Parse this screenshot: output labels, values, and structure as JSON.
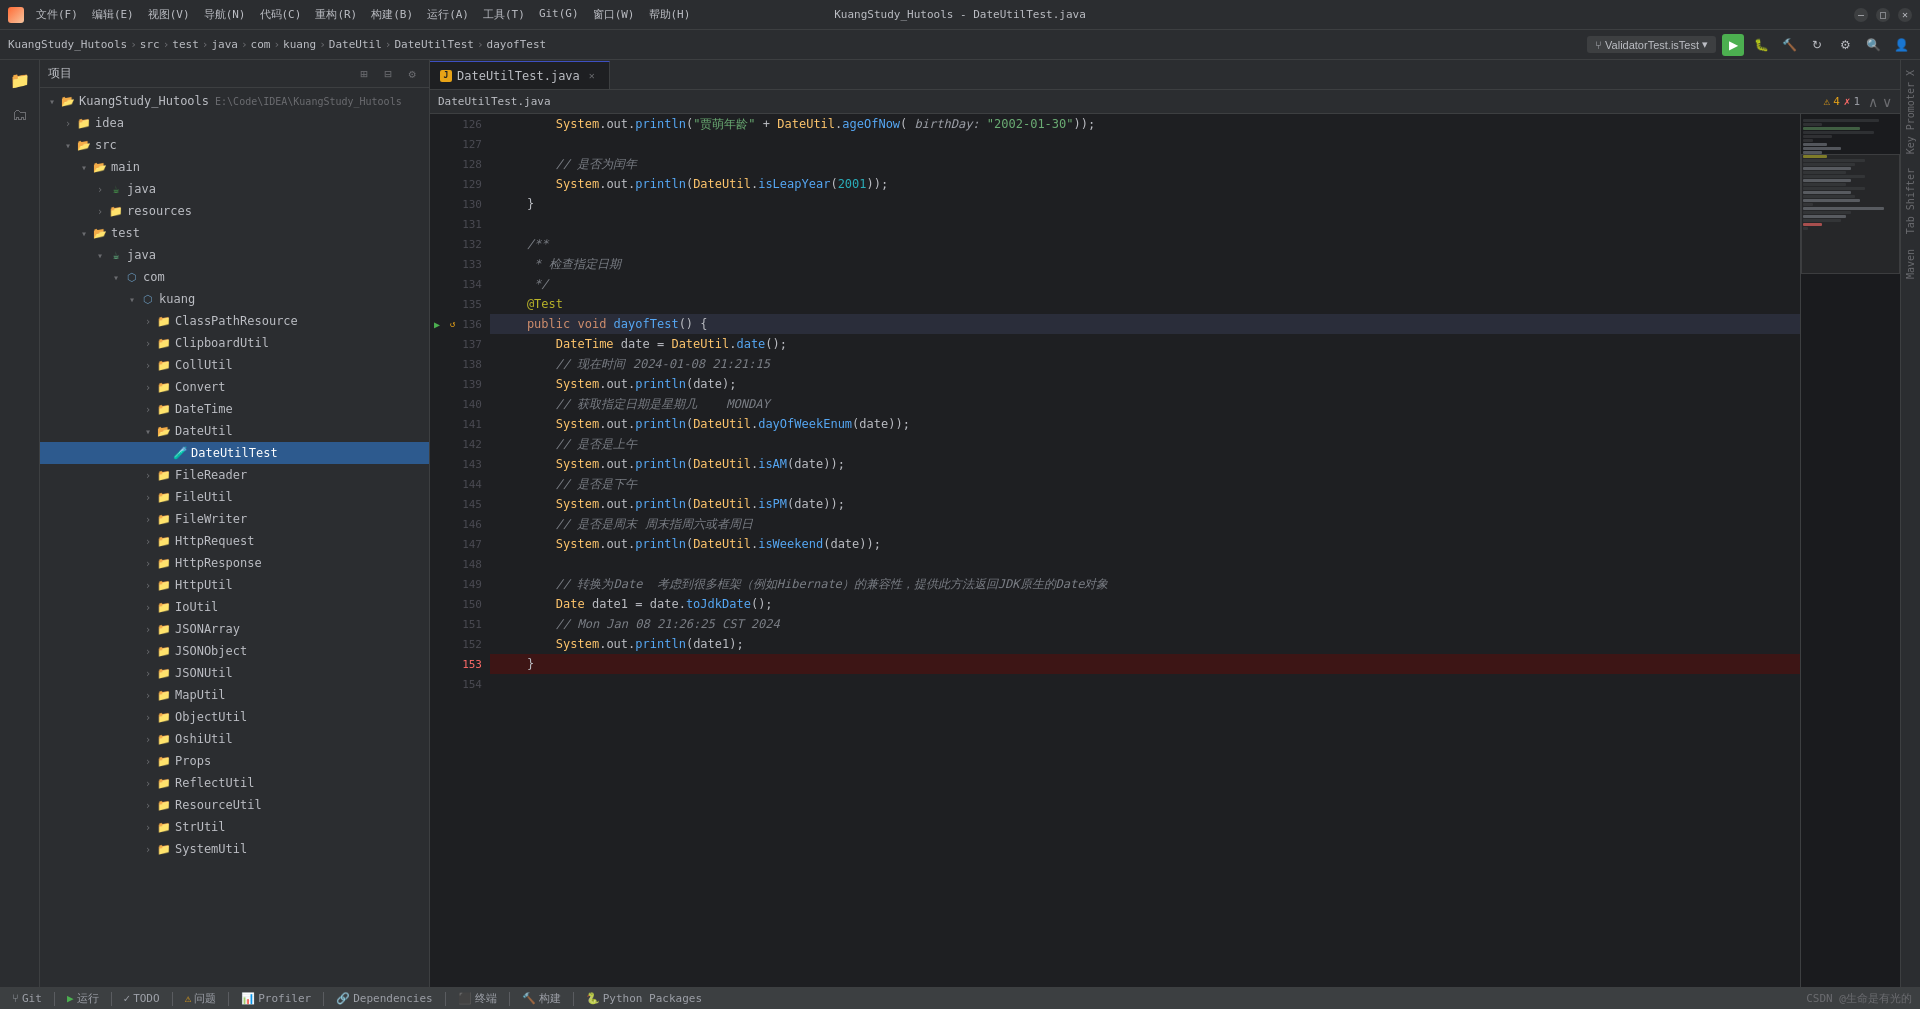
{
  "window": {
    "title": "KuangStudy_Hutools - DateUtilTest.java"
  },
  "titlebar": {
    "logo": "K",
    "menus": [
      "文件(F)",
      "编辑(E)",
      "视图(V)",
      "导航(N)",
      "代码(C)",
      "重构(R)",
      "构建(B)",
      "运行(A)",
      "工具(T)",
      "Git(G)",
      "窗口(W)",
      "帮助(H)"
    ],
    "branch": "ValidatorTest.isTest",
    "window_title": "KuangStudy_Hutools - DateUtilTest.java",
    "min_btn": "—",
    "max_btn": "□",
    "close_btn": "✕"
  },
  "breadcrumb": {
    "items": [
      "KuangStudy_Hutools",
      "src",
      "test",
      "java",
      "com",
      "kuang",
      "DateUtil",
      "DateUtilTest",
      "dayofTest"
    ]
  },
  "sidebar": {
    "title": "项目",
    "root": "KuangStudy_Hutools",
    "root_path": "E:\\Code\\IDEA\\KuangStudy_Hutools",
    "tree": [
      {
        "id": "root",
        "label": "KuangStudy_Hutools",
        "path": "E:\\Code\\IDEA\\KuangStudy_Hutools",
        "type": "project",
        "level": 0,
        "expanded": true
      },
      {
        "id": "idea",
        "label": "idea",
        "type": "folder",
        "level": 1,
        "expanded": false
      },
      {
        "id": "src",
        "label": "src",
        "type": "folder",
        "level": 1,
        "expanded": true
      },
      {
        "id": "main",
        "label": "main",
        "type": "folder",
        "level": 2,
        "expanded": true
      },
      {
        "id": "java-main",
        "label": "java",
        "type": "source-root",
        "level": 3,
        "expanded": false
      },
      {
        "id": "resources",
        "label": "resources",
        "type": "folder",
        "level": 3,
        "expanded": false
      },
      {
        "id": "test",
        "label": "test",
        "type": "folder",
        "level": 2,
        "expanded": true
      },
      {
        "id": "java-test",
        "label": "java",
        "type": "source-root",
        "level": 3,
        "expanded": true
      },
      {
        "id": "com",
        "label": "com",
        "type": "package",
        "level": 4,
        "expanded": true
      },
      {
        "id": "kuang",
        "label": "kuang",
        "type": "package",
        "level": 5,
        "expanded": true
      },
      {
        "id": "ClassPathResource",
        "label": "ClassPathResource",
        "type": "folder",
        "level": 6,
        "expanded": false
      },
      {
        "id": "ClipboardUtil",
        "label": "ClipboardUtil",
        "type": "folder",
        "level": 6,
        "expanded": false
      },
      {
        "id": "CollUtil",
        "label": "CollUtil",
        "type": "folder",
        "level": 6,
        "expanded": false
      },
      {
        "id": "Convert",
        "label": "Convert",
        "type": "folder",
        "level": 6,
        "expanded": false
      },
      {
        "id": "DateTime",
        "label": "DateTime",
        "type": "folder",
        "level": 6,
        "expanded": false
      },
      {
        "id": "DateUtil",
        "label": "DateUtil",
        "type": "folder",
        "level": 6,
        "expanded": true
      },
      {
        "id": "DateUtilTest",
        "label": "DateUtilTest",
        "type": "test-java",
        "level": 7,
        "expanded": false,
        "selected": true
      },
      {
        "id": "FileReader",
        "label": "FileReader",
        "type": "folder",
        "level": 6,
        "expanded": false
      },
      {
        "id": "FileUtil",
        "label": "FileUtil",
        "type": "folder",
        "level": 6,
        "expanded": false
      },
      {
        "id": "FileWriter",
        "label": "FileWriter",
        "type": "folder",
        "level": 6,
        "expanded": false
      },
      {
        "id": "HttpRequest",
        "label": "HttpRequest",
        "type": "folder",
        "level": 6,
        "expanded": false
      },
      {
        "id": "HttpResponse",
        "label": "HttpResponse",
        "type": "folder",
        "level": 6,
        "expanded": false
      },
      {
        "id": "HttpUtil",
        "label": "HttpUtil",
        "type": "folder",
        "level": 6,
        "expanded": false
      },
      {
        "id": "IoUtil",
        "label": "IoUtil",
        "type": "folder",
        "level": 6,
        "expanded": false
      },
      {
        "id": "JSONArray",
        "label": "JSONArray",
        "type": "folder",
        "level": 6,
        "expanded": false
      },
      {
        "id": "JSONObject",
        "label": "JSONObject",
        "type": "folder",
        "level": 6,
        "expanded": false
      },
      {
        "id": "JSONUtil",
        "label": "JSONUtil",
        "type": "folder",
        "level": 6,
        "expanded": false
      },
      {
        "id": "MapUtil",
        "label": "MapUtil",
        "type": "folder",
        "level": 6,
        "expanded": false
      },
      {
        "id": "ObjectUtil",
        "label": "ObjectUtil",
        "type": "folder",
        "level": 6,
        "expanded": false
      },
      {
        "id": "OshiUtil",
        "label": "OshiUtil",
        "type": "folder",
        "level": 6,
        "expanded": false
      },
      {
        "id": "Props",
        "label": "Props",
        "type": "folder",
        "level": 6,
        "expanded": false
      },
      {
        "id": "ReflectUtil",
        "label": "ReflectUtil",
        "type": "folder",
        "level": 6,
        "expanded": false
      },
      {
        "id": "ResourceUtil",
        "label": "ResourceUtil",
        "type": "folder",
        "level": 6,
        "expanded": false
      },
      {
        "id": "StrUtil",
        "label": "StrUtil",
        "type": "folder",
        "level": 6,
        "expanded": false
      },
      {
        "id": "SystemUtil",
        "label": "SystemUtil",
        "type": "folder",
        "level": 6,
        "expanded": false
      }
    ]
  },
  "editor": {
    "tab": "DateUtilTest.java",
    "warnings": "4",
    "errors": "1",
    "lines": [
      {
        "num": 126,
        "content": "        System.out.println(\"贾萌年龄\" + DateUtil.ageOfNow( birthDay: \"2002-01-30\"));"
      },
      {
        "num": 127,
        "content": ""
      },
      {
        "num": 128,
        "content": "        // 是否为闰年"
      },
      {
        "num": 129,
        "content": "        System.out.println(DateUtil.isLeapYear(2001));"
      },
      {
        "num": 130,
        "content": "    }"
      },
      {
        "num": 131,
        "content": ""
      },
      {
        "num": 132,
        "content": "    /**"
      },
      {
        "num": 133,
        "content": "     * 检查指定日期"
      },
      {
        "num": 134,
        "content": "     */"
      },
      {
        "num": 135,
        "content": "    @Test"
      },
      {
        "num": 136,
        "content": "    public void dayofTest() {",
        "has_run": true,
        "has_warn": true
      },
      {
        "num": 137,
        "content": "        DateTime date = DateUtil.date();"
      },
      {
        "num": 138,
        "content": "        // 现在时间 2024-01-08 21:21:15"
      },
      {
        "num": 139,
        "content": "        System.out.println(date);"
      },
      {
        "num": 140,
        "content": "        // 获取指定日期是星期几    MONDAY"
      },
      {
        "num": 141,
        "content": "        System.out.println(DateUtil.dayOfWeekEnum(date));"
      },
      {
        "num": 142,
        "content": "        // 是否是上午"
      },
      {
        "num": 143,
        "content": "        System.out.println(DateUtil.isAM(date));"
      },
      {
        "num": 144,
        "content": "        // 是否是下午"
      },
      {
        "num": 145,
        "content": "        System.out.println(DateUtil.isPM(date));"
      },
      {
        "num": 146,
        "content": "        // 是否是周末 周末指周六或者周日"
      },
      {
        "num": 147,
        "content": "        System.out.println(DateUtil.isWeekend(date));"
      },
      {
        "num": 148,
        "content": ""
      },
      {
        "num": 149,
        "content": "        // 转换为Date  考虑到很多框架（例如Hibernate）的兼容性，提供此方法返回JDK原生的Date对象"
      },
      {
        "num": 150,
        "content": "        Date date1 = date.toJdkDate();"
      },
      {
        "num": 151,
        "content": "        // Mon Jan 08 21:26:25 CST 2024"
      },
      {
        "num": 152,
        "content": "        System.out.println(date1);"
      },
      {
        "num": 153,
        "content": "    }",
        "is_error": true
      },
      {
        "num": 154,
        "content": ""
      }
    ]
  },
  "bottom_tabs": [
    {
      "label": "Git",
      "icon": "git"
    },
    {
      "label": "运行",
      "icon": "run"
    },
    {
      "label": "TODO",
      "icon": "todo"
    },
    {
      "label": "问题",
      "icon": "problems"
    },
    {
      "label": "Profiler",
      "icon": "profiler"
    },
    {
      "label": "Dependencies",
      "icon": "deps"
    },
    {
      "label": "终端",
      "icon": "terminal"
    },
    {
      "label": "构建",
      "icon": "build"
    },
    {
      "label": "Python Packages",
      "icon": "python"
    }
  ],
  "status_bar": {
    "git_label": "Git",
    "run_label": "运行",
    "todo_label": "TODO",
    "problems_label": "问题",
    "profiler_label": "Profiler",
    "deps_label": "Dependencies",
    "terminal_label": "终端",
    "build_label": "构建",
    "python_label": "Python Packages",
    "right_text": "CSDN @生命是有光的"
  },
  "right_tabs": [
    "Key Promoter X",
    "Tab Shifter",
    "Maven"
  ],
  "colors": {
    "accent": "#3c3f41",
    "bg": "#1e1f22",
    "sidebar_bg": "#2b2d30",
    "tab_active": "#1e1f22",
    "selected": "#2d5a8e",
    "error_line": "#3d1515",
    "run_green": "#4caf50",
    "warn_yellow": "#e8a317"
  }
}
